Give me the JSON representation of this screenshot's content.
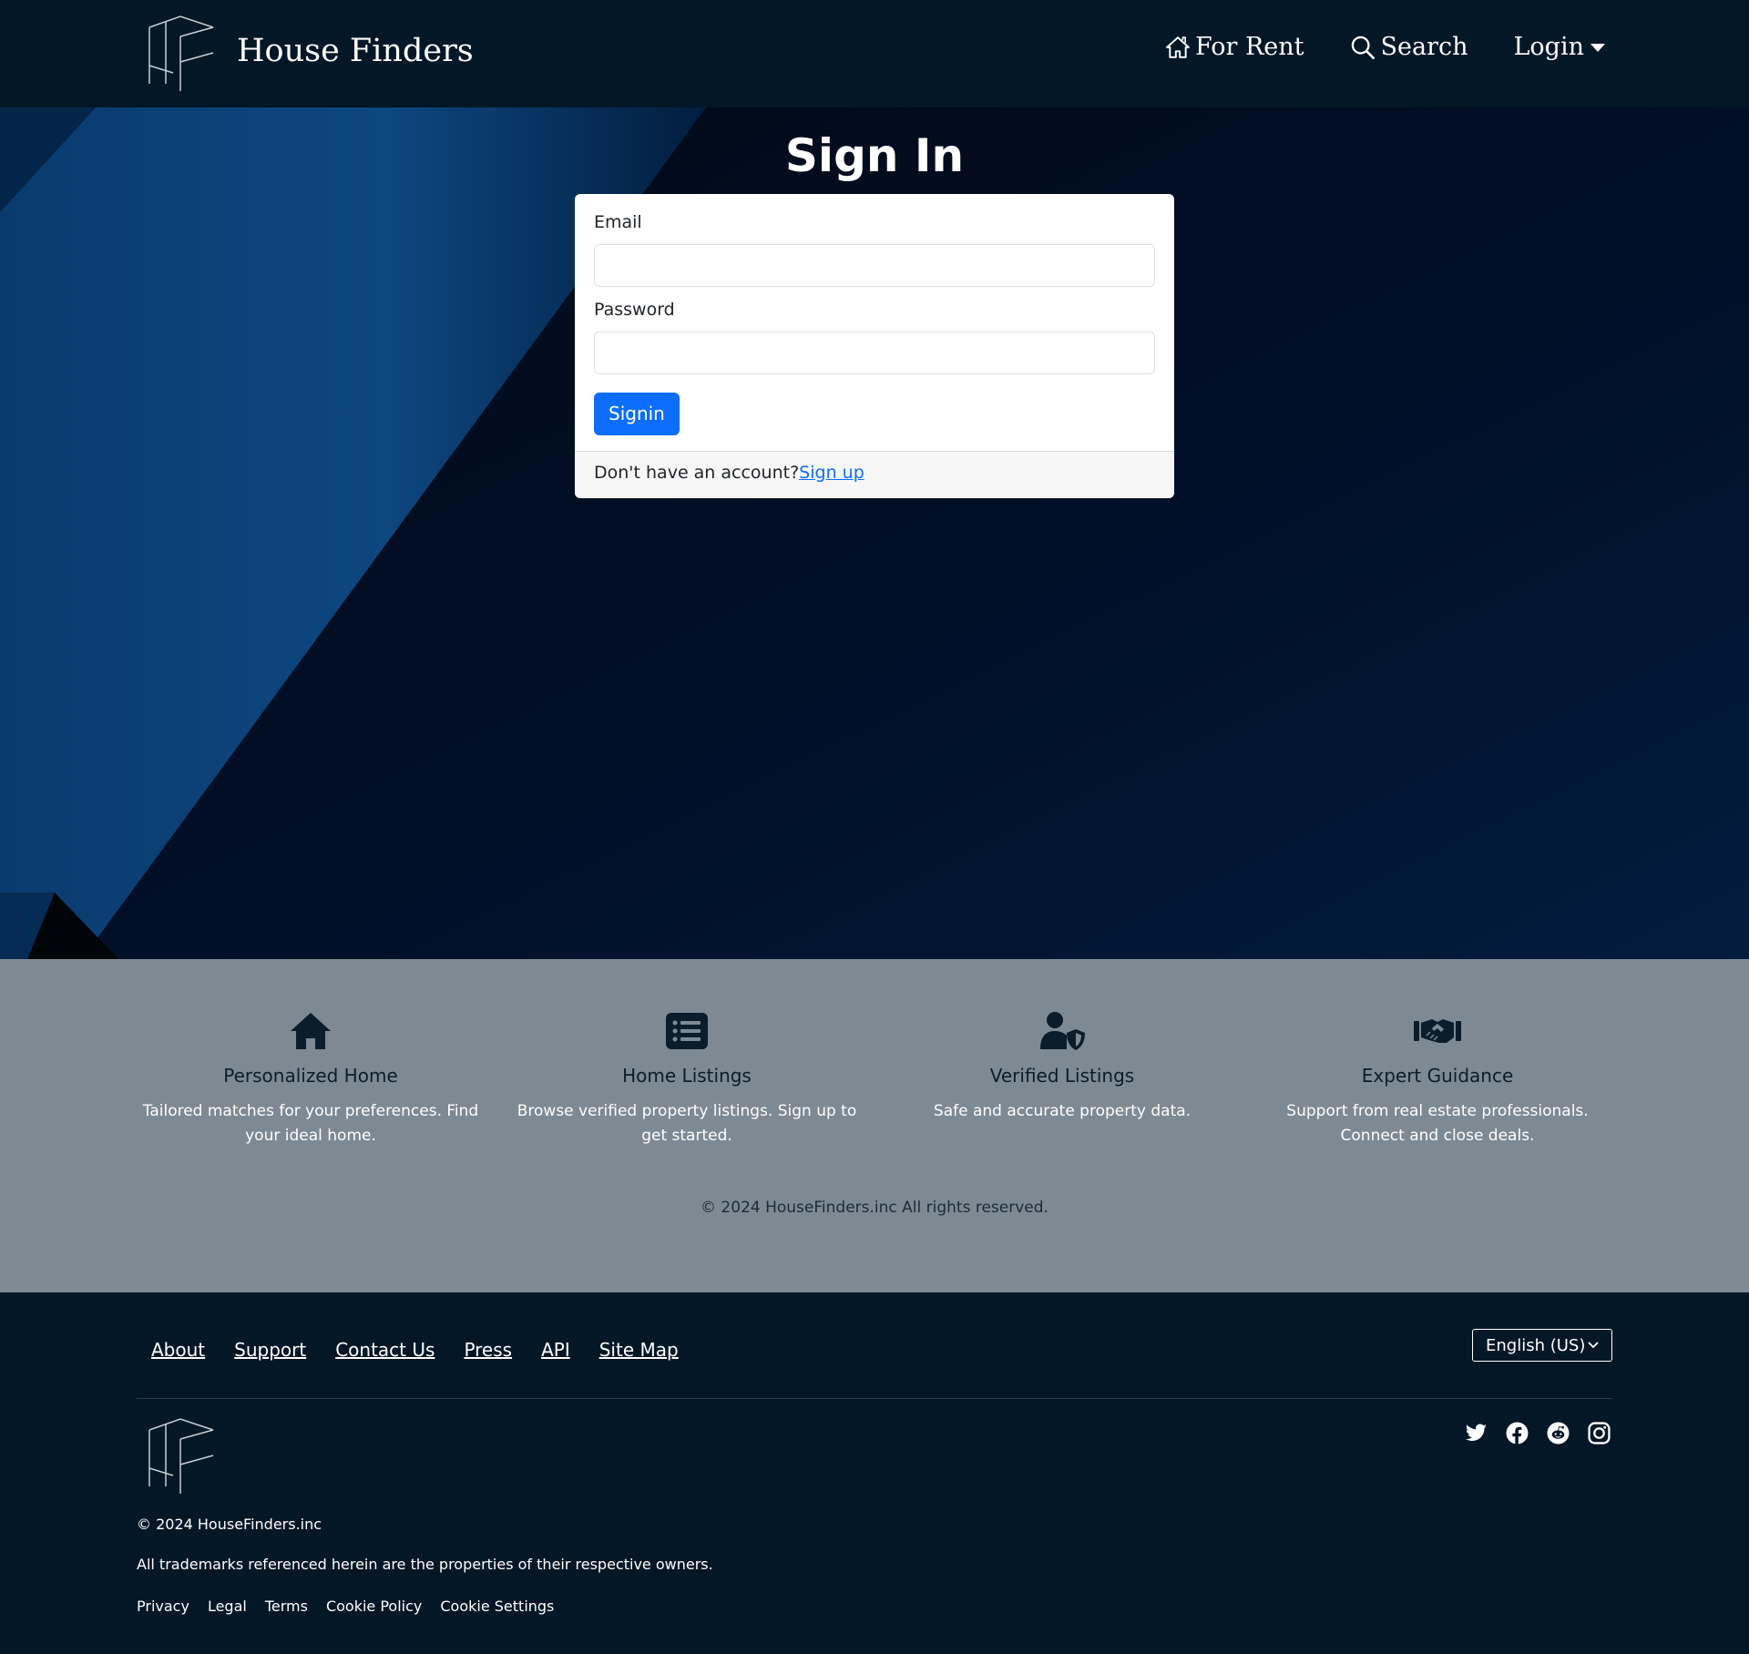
{
  "brand": {
    "name": "House Finders"
  },
  "nav": {
    "for_rent": "For Rent",
    "search": "Search",
    "login": "Login"
  },
  "signin": {
    "title": "Sign In",
    "email_label": "Email",
    "email_value": "",
    "password_label": "Password",
    "password_value": "",
    "submit_label": "Signin",
    "footer_text": "Don't have an account?",
    "signup_link": "Sign up"
  },
  "features": {
    "items": [
      {
        "icon": "house-icon",
        "title": "Personalized Home",
        "desc": "Tailored matches for your preferences. Find your ideal home."
      },
      {
        "icon": "list-icon",
        "title": "Home Listings",
        "desc": "Browse verified property listings. Sign up to get started."
      },
      {
        "icon": "user-shield-icon",
        "title": "Verified Listings",
        "desc": "Safe and accurate property data."
      },
      {
        "icon": "handshake-icon",
        "title": "Expert Guidance",
        "desc": "Support from real estate professionals. Connect and close deals."
      }
    ],
    "copyright": "© 2024 HouseFinders.inc All rights reserved."
  },
  "footer": {
    "links": [
      "About",
      "Support",
      "Contact Us",
      "Press",
      "API",
      "Site Map"
    ],
    "language": "English (US)",
    "social_icons": [
      "twitter-icon",
      "facebook-icon",
      "reddit-icon",
      "instagram-icon"
    ],
    "copyright": "© 2024 HouseFinders.inc",
    "trademark": "All trademarks referenced herein are the properties of their respective owners.",
    "legal_links": [
      "Privacy",
      "Legal",
      "Terms",
      "Cookie Policy",
      "Cookie Settings"
    ]
  },
  "colors": {
    "navbar_bg": "#031727",
    "primary_button": "#0d6efd",
    "features_bg": "#7d8a94",
    "footer_bg": "#031727"
  }
}
